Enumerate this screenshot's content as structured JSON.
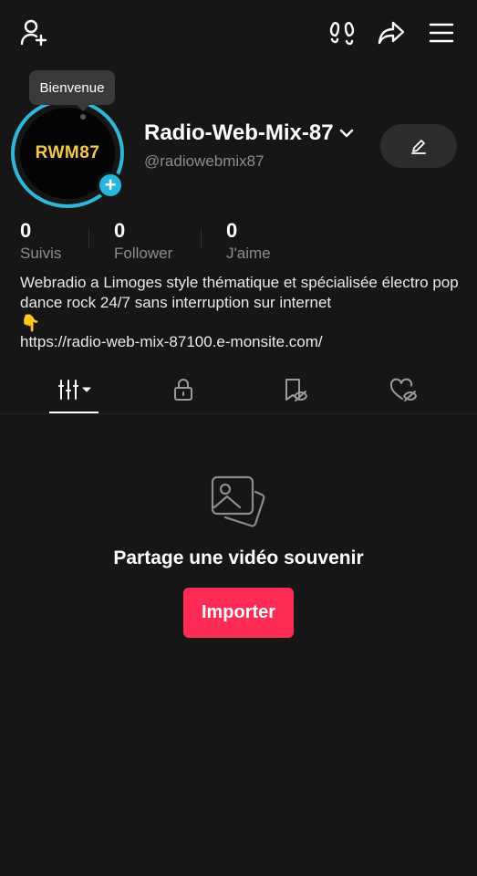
{
  "header": {
    "icons": [
      "add-user-icon",
      "footprints-icon",
      "share-icon",
      "menu-icon"
    ]
  },
  "profile": {
    "tooltip": "Bienvenue",
    "avatar_text": "RWM87",
    "display_name": "Radio-Web-Mix-87",
    "handle": "@radiowebmix87",
    "edit_icon": "pencil-icon"
  },
  "stats": [
    {
      "value": "0",
      "label": "Suivis"
    },
    {
      "value": "0",
      "label": "Follower"
    },
    {
      "value": "0",
      "label": "J'aime"
    }
  ],
  "bio": {
    "text": "Webradio a Limoges style thématique et spécialisée électro pop dance rock 24/7 sans interruption sur internet",
    "emoji": "👇",
    "link": "https://radio-web-mix-87100.e-monsite.com/"
  },
  "tabs": [
    {
      "icon": "videos-grid-icon",
      "active": true
    },
    {
      "icon": "lock-icon",
      "active": false
    },
    {
      "icon": "saved-hidden-icon",
      "active": false
    },
    {
      "icon": "liked-hidden-icon",
      "active": false
    }
  ],
  "empty_state": {
    "icon": "photos-icon",
    "title": "Partage une vidéo souvenir",
    "button_label": "Importer"
  },
  "colors": {
    "background": "#161616",
    "accent": "#fe2c55",
    "ring": "#2fb8d6",
    "secondary_text": "#8c8c8c"
  }
}
